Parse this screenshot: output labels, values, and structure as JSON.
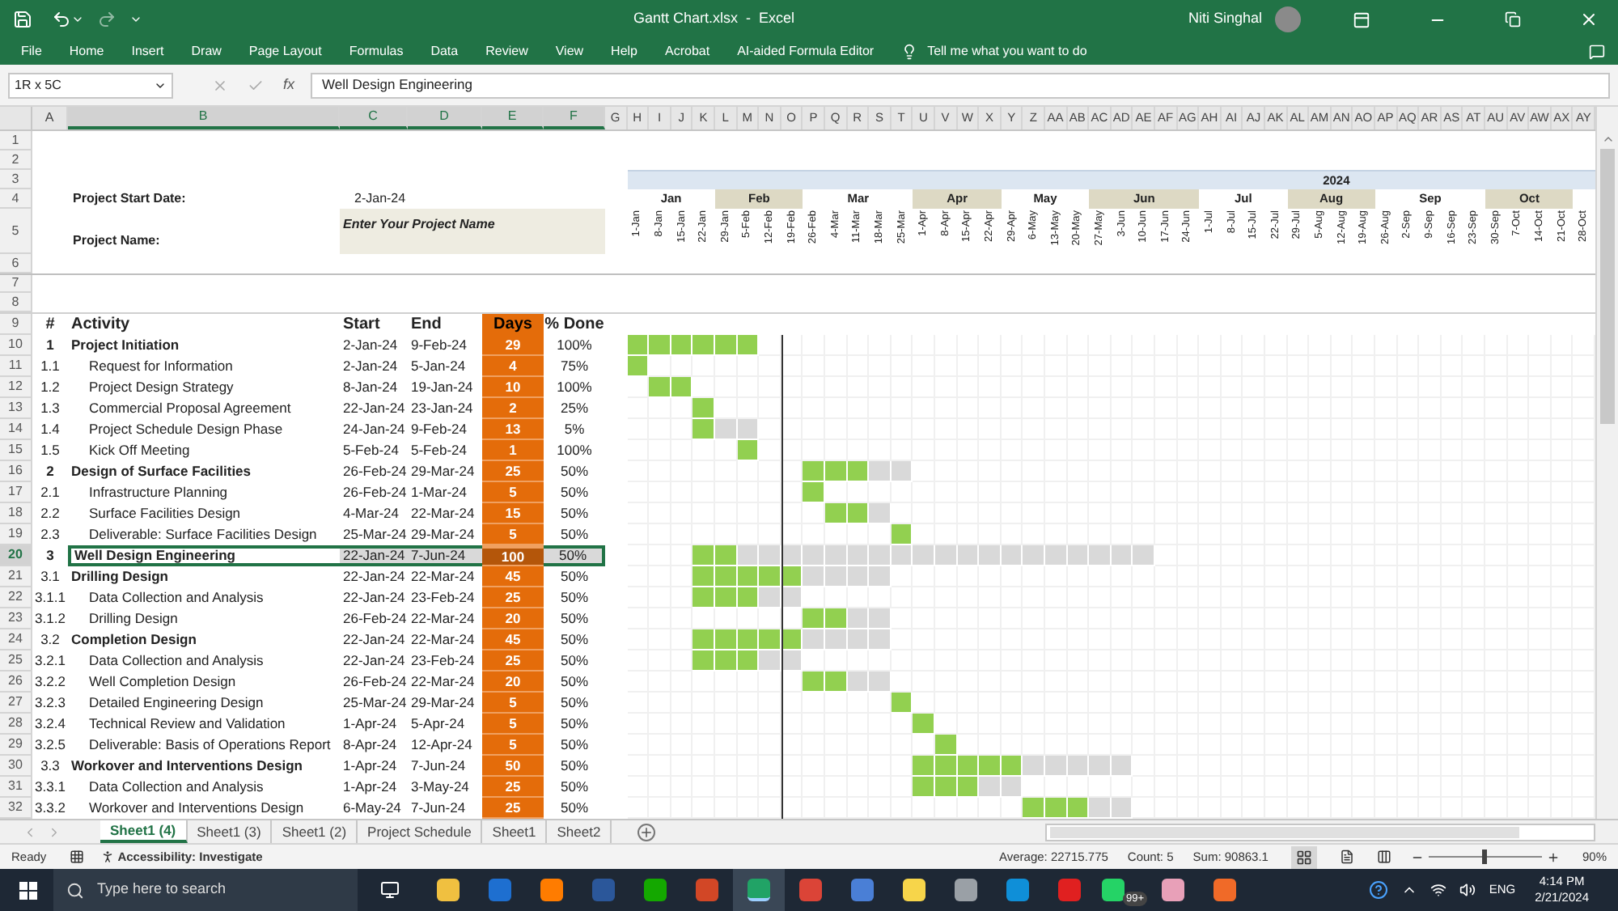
{
  "window": {
    "title": "Gantt Chart.xlsx  -  Excel",
    "user": "Niti Singhal"
  },
  "ribbon_tabs": [
    "File",
    "Home",
    "Insert",
    "Draw",
    "Page Layout",
    "Formulas",
    "Data",
    "Review",
    "View",
    "Help",
    "Acrobat",
    "AI-aided Formula Editor"
  ],
  "tell_me": "Tell me what you want to do",
  "formula_bar": {
    "name_box": "1R x 5C",
    "function_label": "fx",
    "formula": "Well Design Engineering"
  },
  "sheet": {
    "columns": [
      {
        "label": "A",
        "selected": false
      },
      {
        "label": "B",
        "selected": true
      },
      {
        "label": "C",
        "selected": true
      },
      {
        "label": "D",
        "selected": true
      },
      {
        "label": "E",
        "selected": true
      },
      {
        "label": "F",
        "selected": true
      },
      {
        "label": "G",
        "selected": false
      },
      {
        "label": "H",
        "selected": false
      },
      {
        "label": "I",
        "selected": false
      },
      {
        "label": "J",
        "selected": false
      },
      {
        "label": "K",
        "selected": false
      },
      {
        "label": "L",
        "selected": false
      },
      {
        "label": "M",
        "selected": false
      },
      {
        "label": "N",
        "selected": false
      },
      {
        "label": "O",
        "selected": false
      },
      {
        "label": "P",
        "selected": false
      },
      {
        "label": "Q",
        "selected": false
      },
      {
        "label": "R",
        "selected": false
      },
      {
        "label": "S",
        "selected": false
      },
      {
        "label": "T",
        "selected": false
      },
      {
        "label": "U",
        "selected": false
      },
      {
        "label": "V",
        "selected": false
      },
      {
        "label": "W",
        "selected": false
      },
      {
        "label": "X",
        "selected": false
      },
      {
        "label": "Y",
        "selected": false
      },
      {
        "label": "Z",
        "selected": false
      },
      {
        "label": "AA",
        "selected": false
      },
      {
        "label": "AB",
        "selected": false
      },
      {
        "label": "AC",
        "selected": false
      },
      {
        "label": "AD",
        "selected": false
      },
      {
        "label": "AE",
        "selected": false
      },
      {
        "label": "AF",
        "selected": false
      },
      {
        "label": "AG",
        "selected": false
      },
      {
        "label": "AH",
        "selected": false
      },
      {
        "label": "AI",
        "selected": false
      },
      {
        "label": "AJ",
        "selected": false
      },
      {
        "label": "AK",
        "selected": false
      },
      {
        "label": "AL",
        "selected": false
      },
      {
        "label": "AM",
        "selected": false
      },
      {
        "label": "AN",
        "selected": false
      },
      {
        "label": "AO",
        "selected": false
      },
      {
        "label": "AP",
        "selected": false
      },
      {
        "label": "AQ",
        "selected": false
      },
      {
        "label": "AR",
        "selected": false
      },
      {
        "label": "AS",
        "selected": false
      },
      {
        "label": "AT",
        "selected": false
      },
      {
        "label": "AU",
        "selected": false
      },
      {
        "label": "AV",
        "selected": false
      },
      {
        "label": "AW",
        "selected": false
      },
      {
        "label": "AX",
        "selected": false
      },
      {
        "label": "AY",
        "selected": false
      }
    ],
    "top_rows": [
      "1",
      "2",
      "3",
      "4",
      "5",
      "6",
      "7",
      "8",
      "9"
    ],
    "project": {
      "start_label": "Project Start Date:",
      "start_value": "2-Jan-24",
      "name_label": "Project Name:",
      "name_value": "Enter Your Project Name"
    },
    "timeline": {
      "year": "2024",
      "months": [
        {
          "label": "Jan",
          "shaded": false,
          "weeks": [
            {
              "label": "1-Jan",
              "today": false
            },
            {
              "label": "8-Jan",
              "today": false
            },
            {
              "label": "15-Jan",
              "today": false
            },
            {
              "label": "22-Jan",
              "today": false
            }
          ]
        },
        {
          "label": "Feb",
          "shaded": true,
          "weeks": [
            {
              "label": "29-Jan",
              "today": false
            },
            {
              "label": "5-Feb",
              "today": false
            },
            {
              "label": "12-Feb",
              "today": false
            },
            {
              "label": "19-Feb",
              "today": true
            }
          ]
        },
        {
          "label": "Mar",
          "shaded": false,
          "weeks": [
            {
              "label": "26-Feb",
              "today": false
            },
            {
              "label": "4-Mar",
              "today": false
            },
            {
              "label": "11-Mar",
              "today": false
            },
            {
              "label": "18-Mar",
              "today": false
            },
            {
              "label": "25-Mar",
              "today": false
            }
          ]
        },
        {
          "label": "Apr",
          "shaded": true,
          "weeks": [
            {
              "label": "1-Apr",
              "today": false
            },
            {
              "label": "8-Apr",
              "today": false
            },
            {
              "label": "15-Apr",
              "today": false
            },
            {
              "label": "22-Apr",
              "today": false
            }
          ]
        },
        {
          "label": "May",
          "shaded": false,
          "weeks": [
            {
              "label": "29-Apr",
              "today": false
            },
            {
              "label": "6-May",
              "today": false
            },
            {
              "label": "13-May",
              "today": false
            },
            {
              "label": "20-May",
              "today": false
            }
          ]
        },
        {
          "label": "Jun",
          "shaded": true,
          "weeks": [
            {
              "label": "27-May",
              "today": false
            },
            {
              "label": "3-Jun",
              "today": false
            },
            {
              "label": "10-Jun",
              "today": false
            },
            {
              "label": "17-Jun",
              "today": false
            },
            {
              "label": "24-Jun",
              "today": false
            }
          ]
        },
        {
          "label": "Jul",
          "shaded": false,
          "weeks": [
            {
              "label": "1-Jul",
              "today": false
            },
            {
              "label": "8-Jul",
              "today": false
            },
            {
              "label": "15-Jul",
              "today": false
            },
            {
              "label": "22-Jul",
              "today": false
            }
          ]
        },
        {
          "label": "Aug",
          "shaded": true,
          "weeks": [
            {
              "label": "29-Jul",
              "today": false
            },
            {
              "label": "5-Aug",
              "today": false
            },
            {
              "label": "12-Aug",
              "today": false
            },
            {
              "label": "19-Aug",
              "today": false
            }
          ]
        },
        {
          "label": "Sep",
          "shaded": false,
          "weeks": [
            {
              "label": "26-Aug",
              "today": false
            },
            {
              "label": "2-Sep",
              "today": false
            },
            {
              "label": "9-Sep",
              "today": false
            },
            {
              "label": "16-Sep",
              "today": false
            },
            {
              "label": "23-Sep",
              "today": false
            }
          ]
        },
        {
          "label": "Oct",
          "shaded": true,
          "weeks": [
            {
              "label": "30-Sep",
              "today": false
            },
            {
              "label": "7-Oct",
              "today": false
            },
            {
              "label": "14-Oct",
              "today": false
            },
            {
              "label": "21-Oct",
              "today": false
            }
          ]
        },
        {
          "shaded": false,
          "weeks": [
            {
              "label": "28-Oct",
              "today": false
            }
          ]
        }
      ]
    },
    "table_header": [
      "#",
      "Activity",
      "Start",
      "End",
      "Days",
      "% Done"
    ],
    "rows": [
      {
        "row": "10",
        "num": "1",
        "activity": "Project Initiation",
        "kind": "phase",
        "start": "2-Jan-24",
        "end": "9-Feb-24",
        "days": "29",
        "done": "100%",
        "selected": false,
        "timeline": [
          {
            "kind": "done"
          },
          {
            "kind": "done"
          },
          {
            "kind": "done"
          },
          {
            "kind": "done"
          },
          {
            "kind": "done"
          },
          {
            "kind": "done"
          }
        ]
      },
      {
        "row": "11",
        "num": "1.1",
        "activity": "Request for Information",
        "kind": "task",
        "start": "2-Jan-24",
        "end": "5-Jan-24",
        "days": "4",
        "done": "75%",
        "selected": false,
        "timeline": [
          {
            "kind": "done"
          }
        ]
      },
      {
        "row": "12",
        "num": "1.2",
        "activity": "Project Design Strategy",
        "kind": "task",
        "start": "8-Jan-24",
        "end": "19-Jan-24",
        "days": "10",
        "done": "100%",
        "selected": false,
        "timeline": [
          {
            "kind": "gap"
          },
          {
            "kind": "done"
          },
          {
            "kind": "done"
          }
        ]
      },
      {
        "row": "13",
        "num": "1.3",
        "activity": "Commercial Proposal Agreement",
        "kind": "task",
        "start": "22-Jan-24",
        "end": "23-Jan-24",
        "days": "2",
        "done": "25%",
        "selected": false,
        "timeline": [
          {
            "kind": "gap"
          },
          {
            "kind": "gap"
          },
          {
            "kind": "gap"
          },
          {
            "kind": "done"
          }
        ]
      },
      {
        "row": "14",
        "num": "1.4",
        "activity": "Project Schedule Design Phase",
        "kind": "task",
        "start": "24-Jan-24",
        "end": "9-Feb-24",
        "days": "13",
        "done": "5%",
        "selected": false,
        "timeline": [
          {
            "kind": "gap"
          },
          {
            "kind": "gap"
          },
          {
            "kind": "gap"
          },
          {
            "kind": "done"
          },
          {
            "kind": "todo"
          },
          {
            "kind": "todo"
          }
        ]
      },
      {
        "row": "15",
        "num": "1.5",
        "activity": "Kick Off Meeting",
        "kind": "task",
        "start": "5-Feb-24",
        "end": "5-Feb-24",
        "days": "1",
        "done": "100%",
        "selected": false,
        "timeline": [
          {
            "kind": "gap"
          },
          {
            "kind": "gap"
          },
          {
            "kind": "gap"
          },
          {
            "kind": "gap"
          },
          {
            "kind": "gap"
          },
          {
            "kind": "done"
          }
        ]
      },
      {
        "row": "16",
        "num": "2",
        "activity": "Design of Surface Facilities",
        "kind": "phase",
        "start": "26-Feb-24",
        "end": "29-Mar-24",
        "days": "25",
        "done": "50%",
        "selected": false,
        "timeline": [
          {
            "kind": "gap"
          },
          {
            "kind": "gap"
          },
          {
            "kind": "gap"
          },
          {
            "kind": "gap"
          },
          {
            "kind": "gap"
          },
          {
            "kind": "gap"
          },
          {
            "kind": "gap"
          },
          {
            "kind": "gap"
          },
          {
            "kind": "done"
          },
          {
            "kind": "done"
          },
          {
            "kind": "done"
          },
          {
            "kind": "todo"
          },
          {
            "kind": "todo"
          }
        ]
      },
      {
        "row": "17",
        "num": "2.1",
        "activity": "Infrastructure Planning",
        "kind": "task",
        "start": "26-Feb-24",
        "end": "1-Mar-24",
        "days": "5",
        "done": "50%",
        "selected": false,
        "timeline": [
          {
            "kind": "gap"
          },
          {
            "kind": "gap"
          },
          {
            "kind": "gap"
          },
          {
            "kind": "gap"
          },
          {
            "kind": "gap"
          },
          {
            "kind": "gap"
          },
          {
            "kind": "gap"
          },
          {
            "kind": "gap"
          },
          {
            "kind": "done"
          }
        ]
      },
      {
        "row": "18",
        "num": "2.2",
        "activity": "Surface Facilities Design",
        "kind": "task",
        "start": "4-Mar-24",
        "end": "22-Mar-24",
        "days": "15",
        "done": "50%",
        "selected": false,
        "timeline": [
          {
            "kind": "gap"
          },
          {
            "kind": "gap"
          },
          {
            "kind": "gap"
          },
          {
            "kind": "gap"
          },
          {
            "kind": "gap"
          },
          {
            "kind": "gap"
          },
          {
            "kind": "gap"
          },
          {
            "kind": "gap"
          },
          {
            "kind": "gap"
          },
          {
            "kind": "done"
          },
          {
            "kind": "done"
          },
          {
            "kind": "todo"
          }
        ]
      },
      {
        "row": "19",
        "num": "2.3",
        "activity": "Deliverable: Surface Facilities Design",
        "kind": "task",
        "start": "25-Mar-24",
        "end": "29-Mar-24",
        "days": "5",
        "done": "50%",
        "selected": false,
        "timeline": [
          {
            "kind": "gap"
          },
          {
            "kind": "gap"
          },
          {
            "kind": "gap"
          },
          {
            "kind": "gap"
          },
          {
            "kind": "gap"
          },
          {
            "kind": "gap"
          },
          {
            "kind": "gap"
          },
          {
            "kind": "gap"
          },
          {
            "kind": "gap"
          },
          {
            "kind": "gap"
          },
          {
            "kind": "gap"
          },
          {
            "kind": "gap"
          },
          {
            "kind": "done"
          }
        ]
      },
      {
        "row": "20",
        "num": "3",
        "activity": "Well Design Engineering",
        "kind": "phase",
        "start": "22-Jan-24",
        "end": "7-Jun-24",
        "days": "100",
        "done": "50%",
        "selected": true,
        "timeline": [
          {
            "kind": "gap"
          },
          {
            "kind": "gap"
          },
          {
            "kind": "gap"
          },
          {
            "kind": "done"
          },
          {
            "kind": "done"
          },
          {
            "kind": "todo"
          },
          {
            "kind": "todo"
          },
          {
            "kind": "todo"
          },
          {
            "kind": "todo"
          },
          {
            "kind": "todo"
          },
          {
            "kind": "todo"
          },
          {
            "kind": "todo"
          },
          {
            "kind": "todo"
          },
          {
            "kind": "todo"
          },
          {
            "kind": "todo"
          },
          {
            "kind": "todo"
          },
          {
            "kind": "todo"
          },
          {
            "kind": "todo"
          },
          {
            "kind": "todo"
          },
          {
            "kind": "todo"
          },
          {
            "kind": "todo"
          },
          {
            "kind": "todo"
          },
          {
            "kind": "todo"
          },
          {
            "kind": "todo"
          }
        ]
      },
      {
        "row": "21",
        "num": "3.1",
        "activity": "Drilling Design",
        "kind": "group",
        "start": "22-Jan-24",
        "end": "22-Mar-24",
        "days": "45",
        "done": "50%",
        "selected": false,
        "timeline": [
          {
            "kind": "gap"
          },
          {
            "kind": "gap"
          },
          {
            "kind": "gap"
          },
          {
            "kind": "done"
          },
          {
            "kind": "done"
          },
          {
            "kind": "done"
          },
          {
            "kind": "done"
          },
          {
            "kind": "done"
          },
          {
            "kind": "todo"
          },
          {
            "kind": "todo"
          },
          {
            "kind": "todo"
          },
          {
            "kind": "todo"
          }
        ]
      },
      {
        "row": "22",
        "num": "3.1.1",
        "activity": "Data Collection and Analysis",
        "kind": "task",
        "start": "22-Jan-24",
        "end": "23-Feb-24",
        "days": "25",
        "done": "50%",
        "selected": false,
        "timeline": [
          {
            "kind": "gap"
          },
          {
            "kind": "gap"
          },
          {
            "kind": "gap"
          },
          {
            "kind": "done"
          },
          {
            "kind": "done"
          },
          {
            "kind": "done"
          },
          {
            "kind": "todo"
          },
          {
            "kind": "todo"
          }
        ]
      },
      {
        "row": "23",
        "num": "3.1.2",
        "activity": "Drilling Design",
        "kind": "task",
        "start": "26-Feb-24",
        "end": "22-Mar-24",
        "days": "20",
        "done": "50%",
        "selected": false,
        "timeline": [
          {
            "kind": "gap"
          },
          {
            "kind": "gap"
          },
          {
            "kind": "gap"
          },
          {
            "kind": "gap"
          },
          {
            "kind": "gap"
          },
          {
            "kind": "gap"
          },
          {
            "kind": "gap"
          },
          {
            "kind": "gap"
          },
          {
            "kind": "done"
          },
          {
            "kind": "done"
          },
          {
            "kind": "todo"
          },
          {
            "kind": "todo"
          }
        ]
      },
      {
        "row": "24",
        "num": "3.2",
        "activity": "Completion Design",
        "kind": "group",
        "start": "22-Jan-24",
        "end": "22-Mar-24",
        "days": "45",
        "done": "50%",
        "selected": false,
        "timeline": [
          {
            "kind": "gap"
          },
          {
            "kind": "gap"
          },
          {
            "kind": "gap"
          },
          {
            "kind": "done"
          },
          {
            "kind": "done"
          },
          {
            "kind": "done"
          },
          {
            "kind": "done"
          },
          {
            "kind": "done"
          },
          {
            "kind": "todo"
          },
          {
            "kind": "todo"
          },
          {
            "kind": "todo"
          },
          {
            "kind": "todo"
          }
        ]
      },
      {
        "row": "25",
        "num": "3.2.1",
        "activity": "Data Collection and Analysis",
        "kind": "task",
        "start": "22-Jan-24",
        "end": "23-Feb-24",
        "days": "25",
        "done": "50%",
        "selected": false,
        "timeline": [
          {
            "kind": "gap"
          },
          {
            "kind": "gap"
          },
          {
            "kind": "gap"
          },
          {
            "kind": "done"
          },
          {
            "kind": "done"
          },
          {
            "kind": "done"
          },
          {
            "kind": "todo"
          },
          {
            "kind": "todo"
          }
        ]
      },
      {
        "row": "26",
        "num": "3.2.2",
        "activity": "Well Completion Design",
        "kind": "task",
        "start": "26-Feb-24",
        "end": "22-Mar-24",
        "days": "20",
        "done": "50%",
        "selected": false,
        "timeline": [
          {
            "kind": "gap"
          },
          {
            "kind": "gap"
          },
          {
            "kind": "gap"
          },
          {
            "kind": "gap"
          },
          {
            "kind": "gap"
          },
          {
            "kind": "gap"
          },
          {
            "kind": "gap"
          },
          {
            "kind": "gap"
          },
          {
            "kind": "done"
          },
          {
            "kind": "done"
          },
          {
            "kind": "todo"
          },
          {
            "kind": "todo"
          }
        ]
      },
      {
        "row": "27",
        "num": "3.2.3",
        "activity": "Detailed Engineering Design",
        "kind": "task",
        "start": "25-Mar-24",
        "end": "29-Mar-24",
        "days": "5",
        "done": "50%",
        "selected": false,
        "timeline": [
          {
            "kind": "gap"
          },
          {
            "kind": "gap"
          },
          {
            "kind": "gap"
          },
          {
            "kind": "gap"
          },
          {
            "kind": "gap"
          },
          {
            "kind": "gap"
          },
          {
            "kind": "gap"
          },
          {
            "kind": "gap"
          },
          {
            "kind": "gap"
          },
          {
            "kind": "gap"
          },
          {
            "kind": "gap"
          },
          {
            "kind": "gap"
          },
          {
            "kind": "done"
          }
        ]
      },
      {
        "row": "28",
        "num": "3.2.4",
        "activity": "Technical Review and Validation",
        "kind": "task",
        "start": "1-Apr-24",
        "end": "5-Apr-24",
        "days": "5",
        "done": "50%",
        "selected": false,
        "timeline": [
          {
            "kind": "gap"
          },
          {
            "kind": "gap"
          },
          {
            "kind": "gap"
          },
          {
            "kind": "gap"
          },
          {
            "kind": "gap"
          },
          {
            "kind": "gap"
          },
          {
            "kind": "gap"
          },
          {
            "kind": "gap"
          },
          {
            "kind": "gap"
          },
          {
            "kind": "gap"
          },
          {
            "kind": "gap"
          },
          {
            "kind": "gap"
          },
          {
            "kind": "gap"
          },
          {
            "kind": "done"
          }
        ]
      },
      {
        "row": "29",
        "num": "3.2.5",
        "activity": "Deliverable: Basis of Operations Report",
        "kind": "task",
        "start": "8-Apr-24",
        "end": "12-Apr-24",
        "days": "5",
        "done": "50%",
        "selected": false,
        "timeline": [
          {
            "kind": "gap"
          },
          {
            "kind": "gap"
          },
          {
            "kind": "gap"
          },
          {
            "kind": "gap"
          },
          {
            "kind": "gap"
          },
          {
            "kind": "gap"
          },
          {
            "kind": "gap"
          },
          {
            "kind": "gap"
          },
          {
            "kind": "gap"
          },
          {
            "kind": "gap"
          },
          {
            "kind": "gap"
          },
          {
            "kind": "gap"
          },
          {
            "kind": "gap"
          },
          {
            "kind": "gap"
          },
          {
            "kind": "done"
          }
        ]
      },
      {
        "row": "30",
        "num": "3.3",
        "activity": "Workover and Interventions Design",
        "kind": "group",
        "start": "1-Apr-24",
        "end": "7-Jun-24",
        "days": "50",
        "done": "50%",
        "selected": false,
        "timeline": [
          {
            "kind": "gap"
          },
          {
            "kind": "gap"
          },
          {
            "kind": "gap"
          },
          {
            "kind": "gap"
          },
          {
            "kind": "gap"
          },
          {
            "kind": "gap"
          },
          {
            "kind": "gap"
          },
          {
            "kind": "gap"
          },
          {
            "kind": "gap"
          },
          {
            "kind": "gap"
          },
          {
            "kind": "gap"
          },
          {
            "kind": "gap"
          },
          {
            "kind": "gap"
          },
          {
            "kind": "done"
          },
          {
            "kind": "done"
          },
          {
            "kind": "done"
          },
          {
            "kind": "done"
          },
          {
            "kind": "done"
          },
          {
            "kind": "todo"
          },
          {
            "kind": "todo"
          },
          {
            "kind": "todo"
          },
          {
            "kind": "todo"
          },
          {
            "kind": "todo"
          }
        ]
      },
      {
        "row": "31",
        "num": "3.3.1",
        "activity": "Data Collection and Analysis",
        "kind": "task",
        "start": "1-Apr-24",
        "end": "3-May-24",
        "days": "25",
        "done": "50%",
        "selected": false,
        "timeline": [
          {
            "kind": "gap"
          },
          {
            "kind": "gap"
          },
          {
            "kind": "gap"
          },
          {
            "kind": "gap"
          },
          {
            "kind": "gap"
          },
          {
            "kind": "gap"
          },
          {
            "kind": "gap"
          },
          {
            "kind": "gap"
          },
          {
            "kind": "gap"
          },
          {
            "kind": "gap"
          },
          {
            "kind": "gap"
          },
          {
            "kind": "gap"
          },
          {
            "kind": "gap"
          },
          {
            "kind": "done"
          },
          {
            "kind": "done"
          },
          {
            "kind": "done"
          },
          {
            "kind": "todo"
          },
          {
            "kind": "todo"
          }
        ]
      },
      {
        "row": "32",
        "num": "3.3.2",
        "activity": "Workover and Interventions Design",
        "kind": "task",
        "start": "6-May-24",
        "end": "7-Jun-24",
        "days": "25",
        "done": "50%",
        "selected": false,
        "timeline": [
          {
            "kind": "gap"
          },
          {
            "kind": "gap"
          },
          {
            "kind": "gap"
          },
          {
            "kind": "gap"
          },
          {
            "kind": "gap"
          },
          {
            "kind": "gap"
          },
          {
            "kind": "gap"
          },
          {
            "kind": "gap"
          },
          {
            "kind": "gap"
          },
          {
            "kind": "gap"
          },
          {
            "kind": "gap"
          },
          {
            "kind": "gap"
          },
          {
            "kind": "gap"
          },
          {
            "kind": "gap"
          },
          {
            "kind": "gap"
          },
          {
            "kind": "gap"
          },
          {
            "kind": "gap"
          },
          {
            "kind": "gap"
          },
          {
            "kind": "done"
          },
          {
            "kind": "done"
          },
          {
            "kind": "done"
          },
          {
            "kind": "todo"
          },
          {
            "kind": "todo"
          }
        ]
      }
    ]
  },
  "sheet_tabs": [
    {
      "label": "Sheet1 (4)",
      "selected": true
    },
    {
      "label": "Sheet1 (3)",
      "selected": false
    },
    {
      "label": "Sheet1 (2)",
      "selected": false
    },
    {
      "label": "Project Schedule",
      "selected": false
    },
    {
      "label": "Sheet1",
      "selected": false
    },
    {
      "label": "Sheet2",
      "selected": false
    }
  ],
  "status_bar": {
    "ready": "Ready",
    "accessibility": "Accessibility: Investigate",
    "average": "Average: 22715.775",
    "count": "Count: 5",
    "sum": "Sum: 90863.1",
    "zoom": "90%",
    "zoom_slider": {
      "level": 0.5
    }
  },
  "taskbar": {
    "search_placeholder": "Type here to search",
    "apps": [
      {
        "color": "#f0c040",
        "selected": false
      },
      {
        "color": "#1e6fd0",
        "selected": false
      },
      {
        "color": "#ff7c00",
        "selected": false
      },
      {
        "color": "#2b579a",
        "selected": false
      },
      {
        "color": "#14a800",
        "selected": false
      },
      {
        "color": "#d24726",
        "selected": false
      },
      {
        "color": "#21a366",
        "selected": true
      },
      {
        "color": "#db4437",
        "selected": false
      },
      {
        "color": "#4a7fd6",
        "selected": false
      },
      {
        "color": "#f7d54a",
        "selected": false
      },
      {
        "color": "#9aa0a6",
        "selected": false
      },
      {
        "color": "#0f8fd8",
        "selected": false
      },
      {
        "color": "#e02020",
        "selected": false
      },
      {
        "color": "#25d366",
        "selected": false,
        "badge": "99+"
      },
      {
        "color": "#e8a0b8",
        "selected": false
      },
      {
        "color": "#f06a28",
        "selected": false
      }
    ],
    "language": "ENG",
    "time": "4:14 PM",
    "date": "2/21/2024"
  }
}
